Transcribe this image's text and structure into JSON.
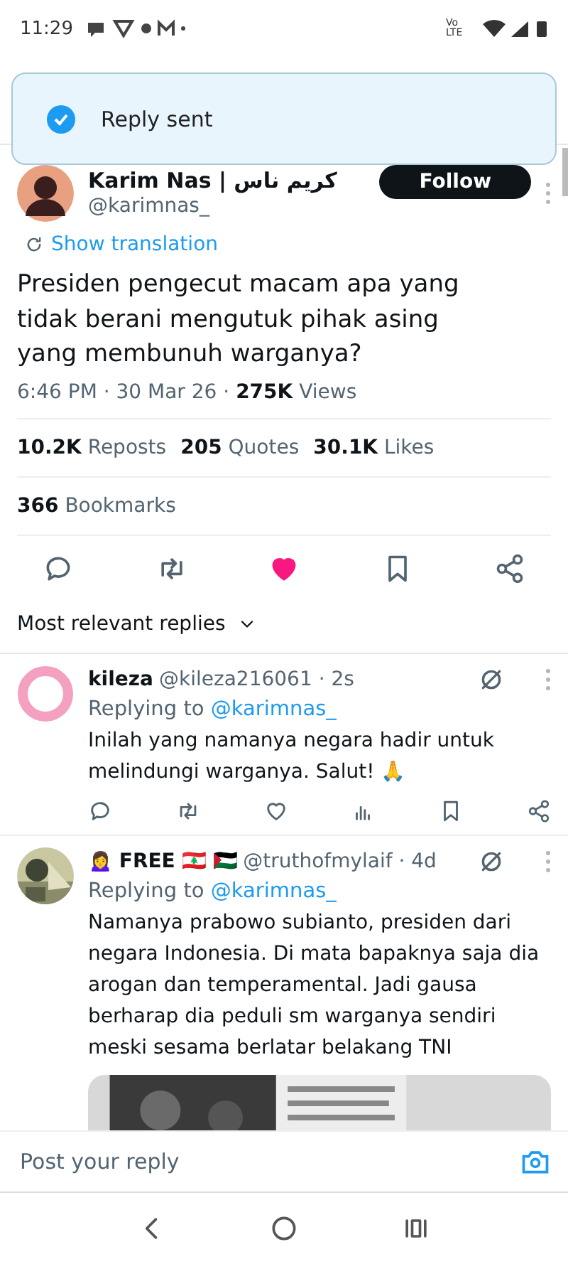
{
  "status_bar": {
    "time": "11:29",
    "network": "Vo LTE"
  },
  "toast": {
    "text": "Reply sent"
  },
  "tweet": {
    "author": "Karim Nas | كريم ناس",
    "handle": "@karimnas_",
    "follow": "Follow",
    "translate": "Show translation",
    "text": "Presiden pengecut macam apa yang tidak berani mengutuk pihak asing yang membunuh warganya?",
    "time": "6:46 PM · 30 Mar 26 · ",
    "views_count": "275K",
    "views_label": " Views",
    "stats": [
      {
        "count": "10.2K",
        "label": "Reposts"
      },
      {
        "count": "205",
        "label": "Quotes"
      },
      {
        "count": "30.1K",
        "label": "Likes"
      }
    ],
    "bookmarks": {
      "count": "366",
      "label": "Bookmarks"
    },
    "actions": [
      {
        "kind": "reply",
        "on": false
      },
      {
        "kind": "repost",
        "on": false
      },
      {
        "kind": "like",
        "on": true
      },
      {
        "kind": "bookmark",
        "on": false
      },
      {
        "kind": "share",
        "on": false
      }
    ]
  },
  "sort": {
    "label": "Most relevant replies"
  },
  "replies": [
    {
      "avatar": {
        "color": "#f4a0c0"
      },
      "name": "kileza",
      "handle": "@kileza216061 · 2s",
      "replying": "Replying to ",
      "mention": "@karimnas_",
      "text": "Inilah yang namanya negara hadir untuk melindungi warganya. Salut! 🙏",
      "actions": true,
      "picture": false
    },
    {
      "name": "🙍‍♀️ FREE 🇱🇧 🇵🇸",
      "handle": "@truthofmylaif · 4d",
      "replying": "Replying to ",
      "mention": "@karimnas_",
      "text": "Namanya prabowo subianto, presiden dari negara Indonesia. Di mata bapaknya saja dia arogan dan temperamental. Jadi gausa berharap dia peduli sm warganya sendiri meski sesama berlatar belakang TNI",
      "actions": false,
      "picture": true
    }
  ],
  "composer": {
    "placeholder": "Post your reply"
  }
}
